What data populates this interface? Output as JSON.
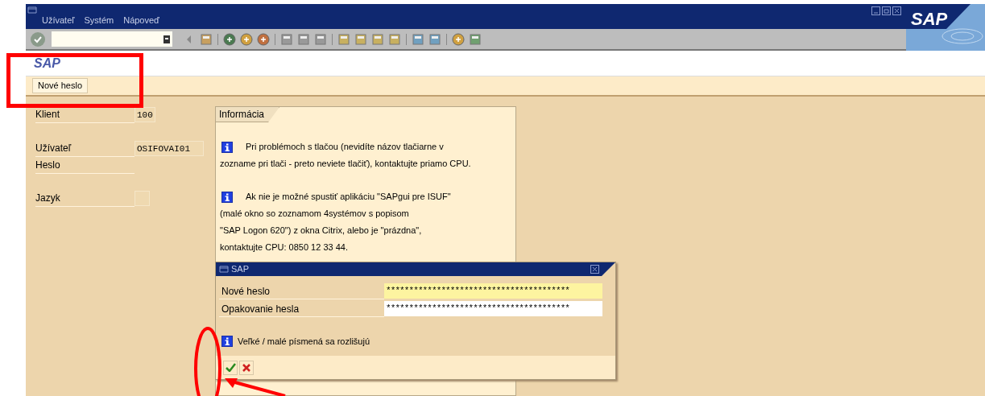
{
  "menu": [
    "Užívateľ",
    "Systém",
    "Nápoveď"
  ],
  "logo": "SAP",
  "screen_title": "SAP",
  "app_toolbar": {
    "buttons": [
      "Nové heslo"
    ]
  },
  "login_fields": [
    {
      "label": "Klient",
      "value": "100",
      "kind": "field"
    },
    {
      "label": "Užívateľ",
      "value": "OSIFOVAI01",
      "kind": "field"
    },
    {
      "label": "Heslo",
      "kind": "hidden"
    },
    {
      "label": "Jazyk",
      "kind": "small"
    }
  ],
  "info_panel": {
    "tab": "Informácia",
    "paragraphs": [
      [
        "Pri problémoch s tlačou (nevidíte názov tlačiarne v",
        "zozname pri tlači - preto neviete tlačiť), kontaktujte priamo CPU."
      ],
      [
        "Ak nie je možné spustiť aplikáciu \"SAPgui pre ISUF\"",
        "(malé okno so zoznamom 4systémov s popisom",
        "\"SAP Logon 620\") z okna Citrix, alebo je \"prázdna\",",
        "kontaktujte CPU: 0850 12 33 44."
      ]
    ]
  },
  "dialog": {
    "title": "SAP",
    "fields": [
      {
        "label": "Nové heslo",
        "value": "****************************************",
        "focused": true
      },
      {
        "label": "Opakovanie hesla",
        "value": "****************************************",
        "focused": false
      }
    ],
    "note": "Veľké / malé písmená sa rozlišujú"
  }
}
